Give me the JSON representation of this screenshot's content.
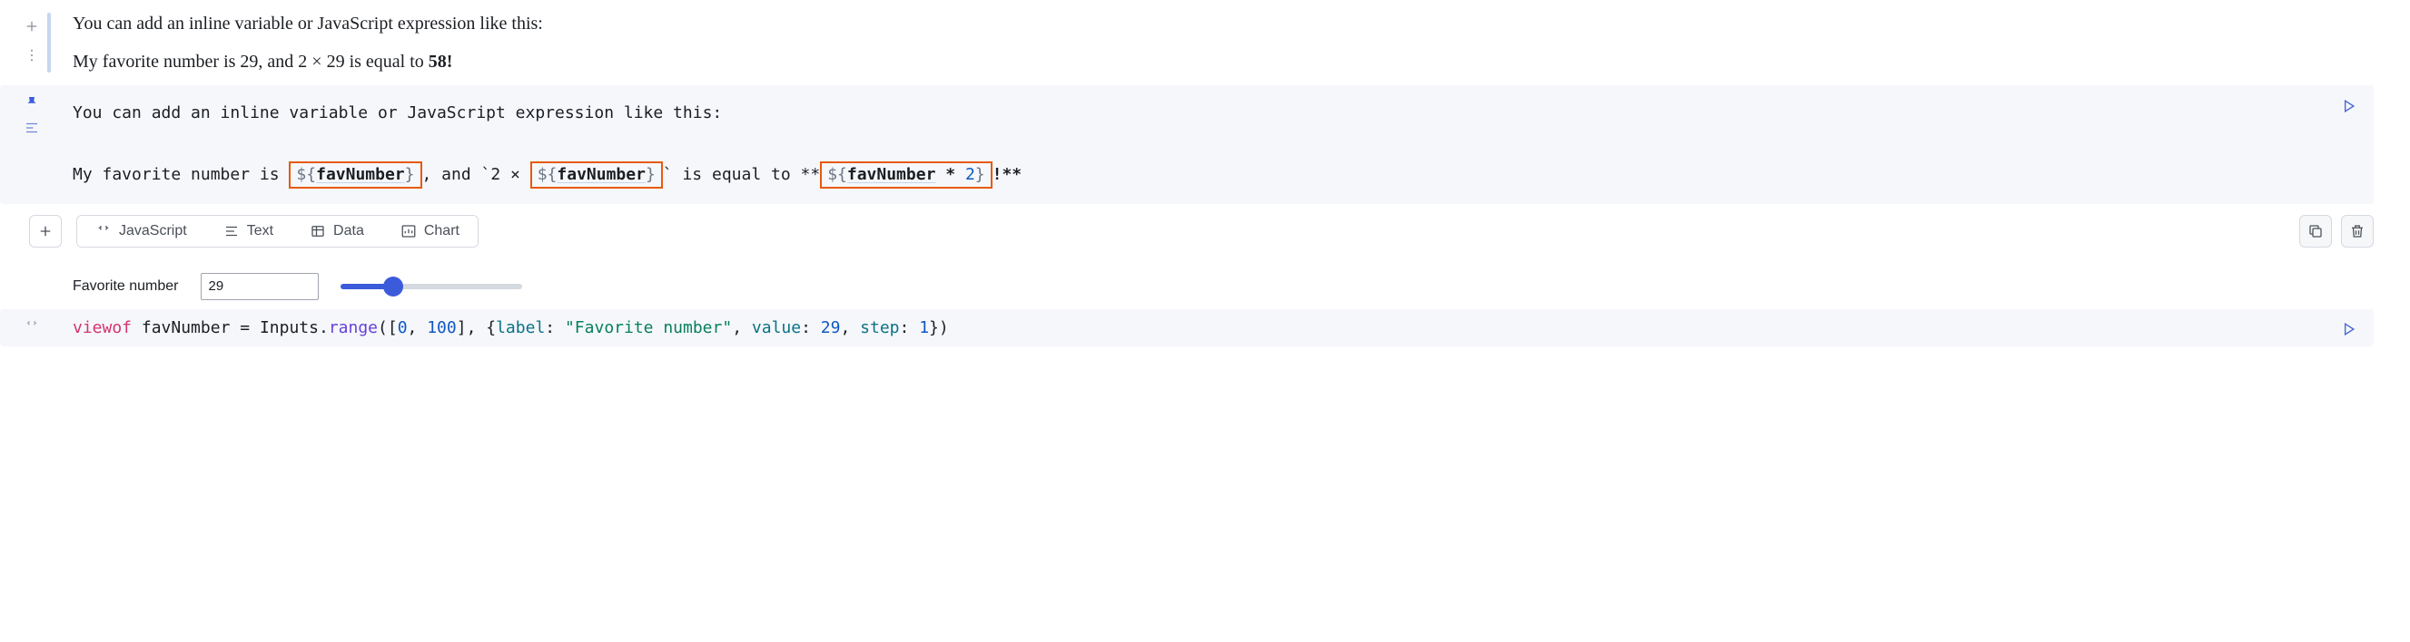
{
  "rendered": {
    "line1": "You can add an inline variable or JavaScript expression like this:",
    "line2_pre": "My favorite number is ",
    "line2_fav": "29",
    "line2_mid": ", and 2  ×  29 is equal to ",
    "line2_result": "58!"
  },
  "editor": {
    "line1": "You can add an inline variable or JavaScript expression like this:",
    "l2_p1": "My favorite number is ",
    "l2_box1_pre": "${",
    "l2_box1_var": "favNumber",
    "l2_box1_post": "}",
    "l2_p2": ",  and `2 × ",
    "l2_box2_pre": "${",
    "l2_box2_var": "favNumber",
    "l2_box2_post": "}",
    "l2_p3": "` is equal to **",
    "l2_box3_pre": "${",
    "l2_box3_var": "favNumber",
    "l2_box3_op": " * ",
    "l2_box3_num": "2",
    "l2_box3_post": "}",
    "l2_p4": "!**"
  },
  "toolbar": {
    "javascript": "JavaScript",
    "text": "Text",
    "data": "Data",
    "chart": "Chart"
  },
  "input": {
    "label": "Favorite number",
    "value": "29",
    "min": 0,
    "max": 100,
    "percent": 29
  },
  "source": {
    "viewof": "viewof",
    "varname": " favNumber ",
    "eq": "= ",
    "obj": "Inputs",
    "dot": ".",
    "method": "range",
    "open": "([",
    "n0": "0",
    "comma1": ", ",
    "n1": "100",
    "close1": "], {",
    "k_label": "label",
    "colon1": ": ",
    "v_label": "\"Favorite number\"",
    "comma2": ", ",
    "k_value": "value",
    "colon2": ": ",
    "v_value": "29",
    "comma3": ", ",
    "k_step": "step",
    "colon3": ": ",
    "v_step": "1",
    "close2": "})"
  }
}
